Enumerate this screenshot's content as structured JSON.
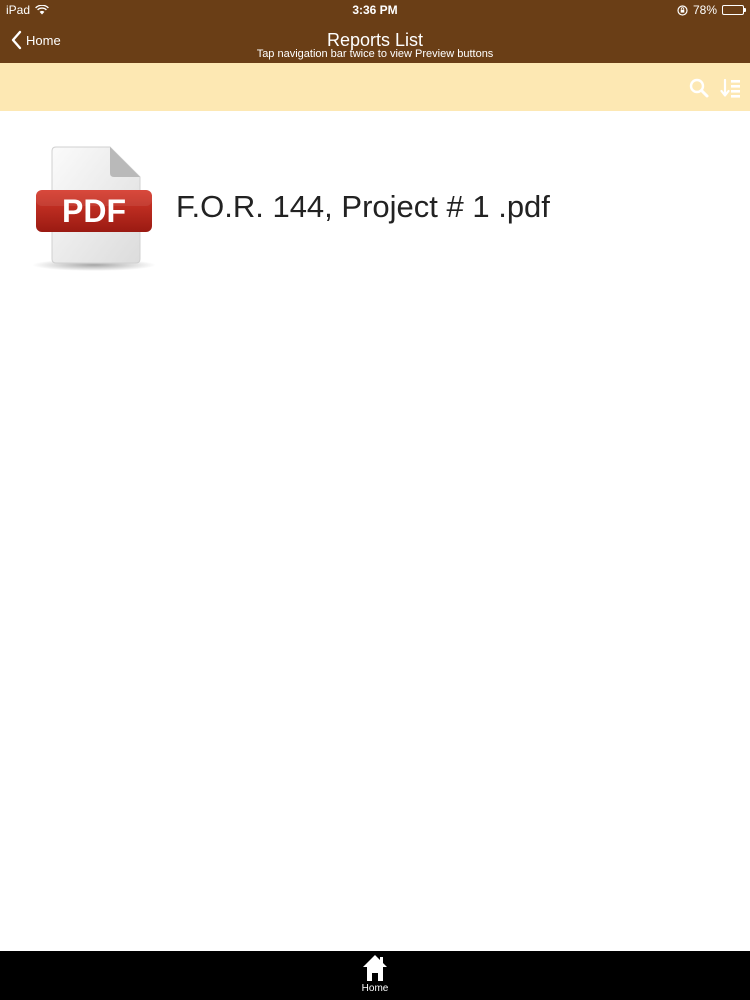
{
  "status_bar": {
    "device": "iPad",
    "time": "3:36 PM",
    "battery_percent": "78%",
    "battery_level": 0.78
  },
  "nav": {
    "back_label": "Home",
    "title": "Reports List",
    "subtitle": "Tap navigation bar twice to view Preview buttons"
  },
  "toolbar": {
    "search_icon": "search-icon",
    "sort_icon": "sort-icon"
  },
  "reports": {
    "items": [
      {
        "icon_label": "PDF",
        "name": "F.O.R. 144, Project # 1 .pdf"
      }
    ]
  },
  "tabbar": {
    "home_label": "Home"
  },
  "colors": {
    "header": "#6a3e16",
    "toolbar": "#fde8b3",
    "pdf_badge": "#b3241c",
    "tabbar": "#000000"
  }
}
